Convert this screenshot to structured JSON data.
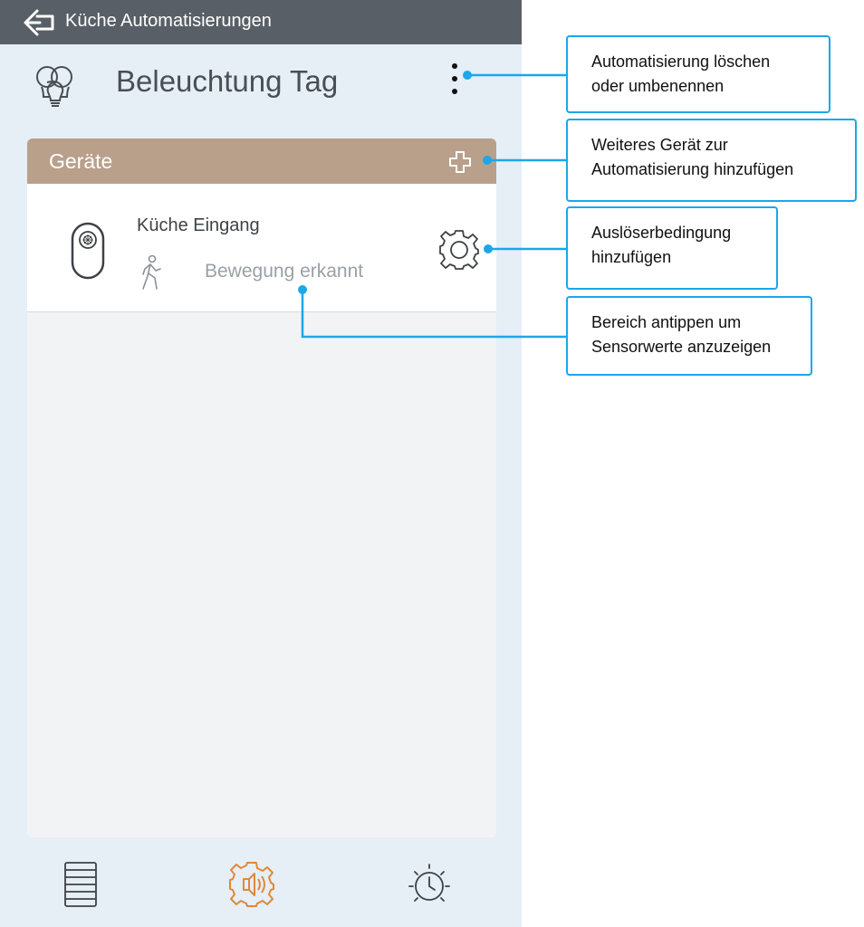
{
  "topbar": {
    "back_icon": "arrow-left-icon",
    "title": "Küche Automatisierungen"
  },
  "header": {
    "icon": "light-bulbs-icon",
    "title": "Beleuchtung Tag",
    "menu_icon": "more-vertical-icon"
  },
  "devices_section": {
    "title": "Geräte",
    "add_icon": "plus-icon",
    "devices": [
      {
        "name": "Küche Eingang",
        "device_icon": "motion-sensor-icon",
        "status_icon": "walking-person-icon",
        "value": "Bewegung erkannt",
        "settings_icon": "gear-icon"
      }
    ]
  },
  "bottom_nav": [
    {
      "icon": "list-icon",
      "active": false
    },
    {
      "icon": "automation-gear-icon",
      "active": true
    },
    {
      "icon": "timer-icon",
      "active": false
    }
  ],
  "callouts": [
    {
      "lines": [
        "Automatisierung löschen",
        "oder umbenennen"
      ]
    },
    {
      "lines": [
        "Weiteres Gerät zur",
        "Automatisierung hinzufügen"
      ]
    },
    {
      "lines": [
        "Auslöserbedingung",
        "hinzufügen"
      ]
    },
    {
      "lines": [
        "Bereich antippen um",
        "Sensorwerte anzuzeigen"
      ]
    }
  ],
  "colors": {
    "topbar": "#585f66",
    "background": "#e6eef6",
    "section_header": "#b8a08b",
    "accent_orange": "#e0893a",
    "callout_border": "#1ba7e8"
  }
}
